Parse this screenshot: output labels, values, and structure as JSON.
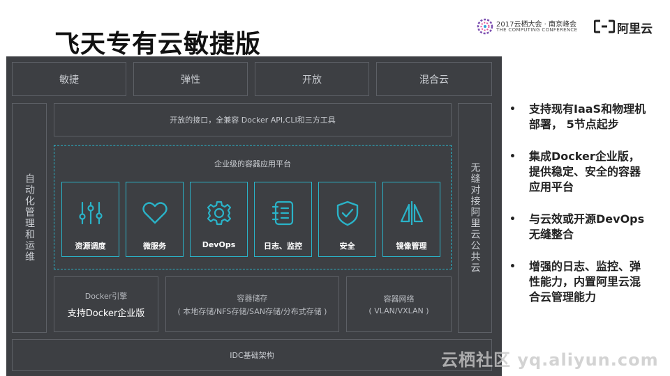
{
  "title": "飞天专有云敏捷版",
  "conference": {
    "line1": "2017云栖大会 · 南京峰会",
    "line2": "THE COMPUTING CONFERENCE"
  },
  "aliyun": {
    "logo_text": "阿里云"
  },
  "diagram": {
    "top_boxes": [
      "敏捷",
      "弹性",
      "开放",
      "混合云"
    ],
    "left_column": "自动化管理和运维",
    "right_column": "无缝对接阿里云公共云",
    "api_bar": "开放的接口，全兼容 Docker API,CLI和三方工具",
    "platform_title": "企业级的容器应用平台",
    "platform_cards": [
      {
        "label": "资源调度",
        "icon": "sliders-icon"
      },
      {
        "label": "微服务",
        "icon": "heart-icon"
      },
      {
        "label": "DevOps",
        "icon": "gear-icon"
      },
      {
        "label": "日志、监控",
        "icon": "notebook-icon"
      },
      {
        "label": "安全",
        "icon": "shield-check-icon"
      },
      {
        "label": "镜像管理",
        "icon": "mirror-icon"
      }
    ],
    "docker_engine": {
      "line1": "Docker引擎",
      "line2": "支持Docker企业版"
    },
    "storage": {
      "line1": "容器储存",
      "line2": "( 本地存储/NFS存储/SAN存储/分布式存储 )"
    },
    "network": {
      "line1": "容器网络",
      "line2": "( VLAN/VXLAN )"
    },
    "idc": "IDC基础架构"
  },
  "bullets": [
    {
      "lines": [
        "支持现有IaaS和物理机",
        "部署， 5节点起步"
      ]
    },
    {
      "lines": [
        "集成Docker企业版，",
        "提供稳定、安全的容器",
        "应用平台"
      ]
    },
    {
      "lines": [
        "与云效或开源DevOps",
        "无缝整合"
      ]
    },
    {
      "lines": [
        "增强的日志、监控、弹",
        "性能力，内置阿里云混",
        "合云管理能力"
      ]
    }
  ],
  "bullet_char": "•",
  "watermark": "云栖社区 yq.aliyun.com",
  "colors": {
    "panel": "#3d3f43",
    "border": "#5d6066",
    "accent": "#2ab3c8",
    "text_light": "#c9ccd1"
  }
}
